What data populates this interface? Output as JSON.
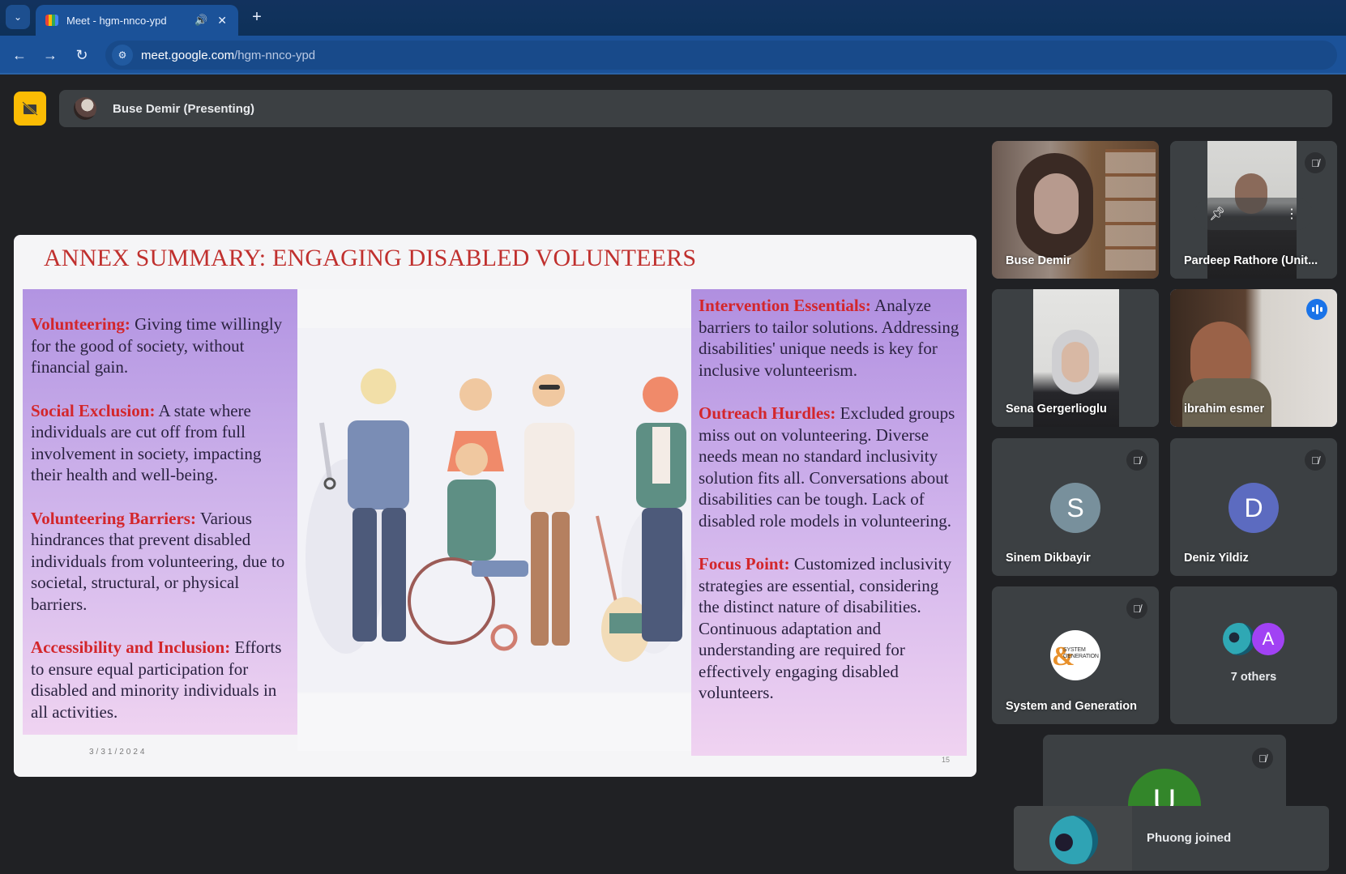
{
  "browser": {
    "tab_title": "Meet - hgm-nnco-ypd",
    "tab_list_icon": "chevron-down-icon",
    "new_tab_icon": "plus-icon",
    "url_host": "meet.google.com",
    "url_path": "/hgm-nnco-ypd",
    "glyphs": {
      "chevron": "⌄",
      "audio": "🔊",
      "close": "✕",
      "plus": "+",
      "back": "←",
      "forward": "→",
      "reload": "↻",
      "site_info": "⚙"
    }
  },
  "meet": {
    "presenter_label": "Buse Demir (Presenting)",
    "presenting_badge_icon": "stop-presenting-icon",
    "slide": {
      "title": "ANNEX SUMMARY: ENGAGING DISABLED VOLUNTEERS",
      "date": "3/31/2024",
      "slide_number": "15",
      "left_items": [
        {
          "term": "Volunteering:",
          "text": " Giving time willingly for the good of society, without financial gain."
        },
        {
          "term": "Social Exclusion:",
          "text": " A state where individuals are cut off from full involvement in society, impacting their health and well-being."
        },
        {
          "term": "Volunteering Barriers:",
          "text": " Various hindrances that prevent disabled individuals from volunteering, due to societal, structural, or physical barriers."
        },
        {
          "term": "Accessibility and Inclusion:",
          "text": " Efforts to ensure equal participation for disabled and minority individuals in all activities."
        }
      ],
      "right_items": [
        {
          "term": "Intervention Essentials:",
          "text": " Analyze barriers to tailor solutions. Addressing disabilities' unique needs is key for inclusive volunteerism."
        },
        {
          "term": "Outreach Hurdles:",
          "text": " Excluded groups miss out on volunteering. Diverse needs mean no standard inclusivity solution fits all. Conversations about disabilities can be tough. Lack of disabled role models in volunteering."
        },
        {
          "term": "Focus Point:",
          "text": " Customized inclusivity strategies are essential, considering the distinct nature of disabilities. Continuous adaptation and understanding are required for effectively engaging disabled volunteers."
        }
      ],
      "illustration": "group-of-diverse-disabled-people-illustration"
    },
    "participants": [
      {
        "name": "Buse Demir",
        "type": "video",
        "muted": false
      },
      {
        "name": "Pardeep Rathore (Unit...",
        "type": "video",
        "muted": true,
        "hovered": true
      },
      {
        "name": "Sena Gergerlioglu",
        "type": "video",
        "muted": false
      },
      {
        "name": "ibrahim esmer",
        "type": "video",
        "muted": false,
        "speaking": true
      },
      {
        "name": "Sinem Dikbayir",
        "type": "avatar",
        "initial": "S",
        "color": "#78909c",
        "muted": true
      },
      {
        "name": "Deniz Yildiz",
        "type": "avatar",
        "initial": "D",
        "color": "#5c6bc0",
        "muted": true
      },
      {
        "name": "System and Generation",
        "type": "logo",
        "logo_text": "SYSTEM GENERATION",
        "logo_amp": "&",
        "muted": true
      },
      {
        "label": "7 others",
        "type": "others",
        "initial": "A",
        "color": "#a142f4"
      },
      {
        "name": "",
        "type": "avatar",
        "initial": "U",
        "color": "#33862a",
        "muted": true
      }
    ],
    "icons": {
      "mic_off": "🎙̸",
      "pin": "📌",
      "more": "⋮"
    },
    "toast": {
      "message": "Phuong joined"
    }
  }
}
